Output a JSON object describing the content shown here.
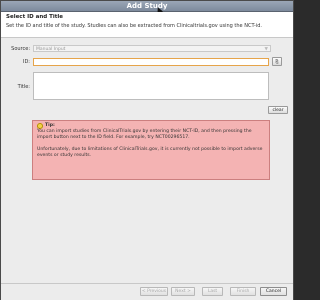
{
  "window": {
    "title": "Add Study"
  },
  "header": {
    "title": "Select ID and Title",
    "description": "Set the ID and title of the study. Studies can also be extracted from Clinicaltrials.gov using the NCT-id."
  },
  "form": {
    "source_label": "Source:",
    "source_value": "Manual Input",
    "id_label": "ID:",
    "id_value": "",
    "title_label": "Title:",
    "title_value": "",
    "import_button_icon": "import-icon",
    "clear_label": "clear"
  },
  "tip": {
    "heading": "Tip:",
    "line1": "You can import studies from ClinicalTrials.gov by entering their NCT-ID, and then pressing the import button next to the ID field. For example, try NCT00296517.",
    "line2": "Unfortunately, due to limitations of ClinicalTrials.gov, it is currently not possible to import adverse events or study results."
  },
  "footer": {
    "prev": "< Previous",
    "next": "Next >",
    "last": "Last",
    "finish": "Finish",
    "cancel": "Cancel"
  }
}
